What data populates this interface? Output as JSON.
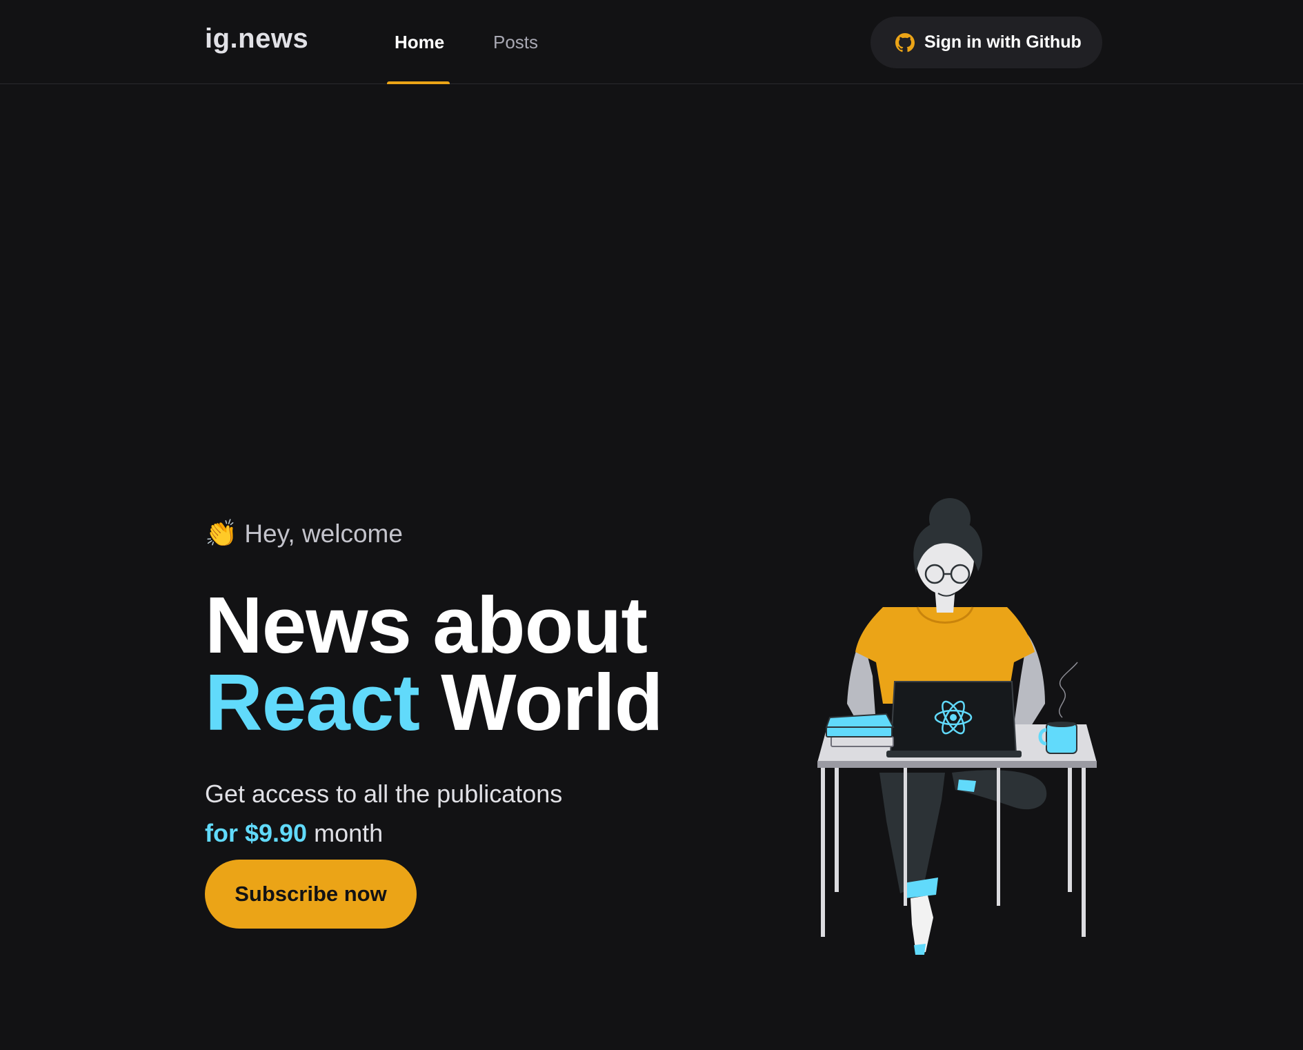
{
  "header": {
    "logo": "ig.news",
    "nav": [
      {
        "label": "Home",
        "active": true
      },
      {
        "label": "Posts",
        "active": false
      }
    ],
    "signin_label": "Sign in with Github",
    "signin_icon": "github-icon"
  },
  "hero": {
    "welcome_emoji": "👏",
    "welcome_text": "Hey, welcome",
    "headline_line1": "News about",
    "headline_accent": "React",
    "headline_rest": " World",
    "desc_line1": "Get access to all the publicatons",
    "desc_price": "for $9.90",
    "desc_suffix": " month",
    "subscribe_label": "Subscribe now"
  },
  "colors": {
    "background": "#121214",
    "accent_yellow": "#eba417",
    "accent_cyan": "#61dafb"
  }
}
